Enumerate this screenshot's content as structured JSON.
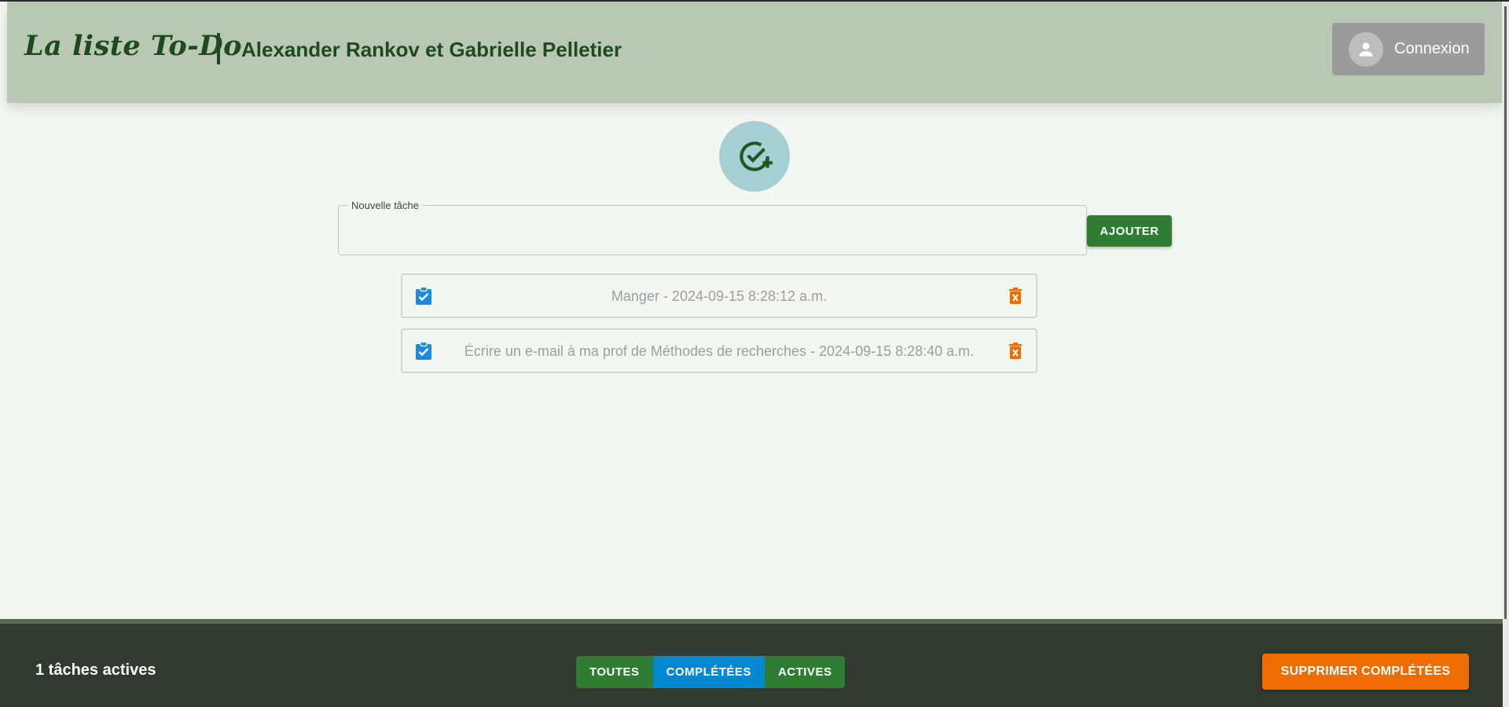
{
  "header": {
    "brand": "La liste To-Do",
    "authors": "Alexander Rankov et Gabrielle Pelletier",
    "login_label": "Connexion"
  },
  "new_task": {
    "label": "Nouvelle tâche",
    "value": "",
    "add_label": "AJOUTER"
  },
  "tasks": [
    {
      "text": "Manger - 2024-09-15 8:28:12 a.m.",
      "completed": true
    },
    {
      "text": "Écrire un e-mail à ma prof de Méthodes de recherches - 2024-09-15 8:28:40 a.m.",
      "completed": true
    }
  ],
  "footer": {
    "active_count": "1 tâches actives",
    "filters": [
      {
        "label": "TOUTES",
        "selected": false
      },
      {
        "label": "COMPLÉTÉES",
        "selected": true
      },
      {
        "label": "ACTIVES",
        "selected": false
      }
    ],
    "clear_label": "SUPPRIMER COMPLÉTÉES"
  },
  "icons": {
    "add_task": "add-task-icon",
    "checkbox": "assignment-turned-in-icon",
    "delete": "delete-forever-icon",
    "avatar": "person-icon"
  },
  "colors": {
    "header_bg": "#b9c8b5",
    "primary_green": "#2e7d32",
    "selected_blue": "#0288d1",
    "delete_orange": "#ef6c00",
    "footer_bg": "#323a2f"
  }
}
